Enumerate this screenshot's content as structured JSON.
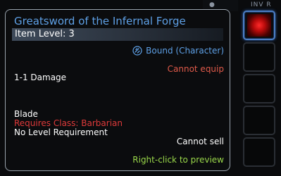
{
  "background": {
    "top_text": "INV R"
  },
  "tooltip": {
    "title": "Greatsword of the Infernal Forge",
    "item_level": "Item Level: 3",
    "bound": "Bound (Character)",
    "cannot_equip": "Cannot equip",
    "damage": "1-1 Damage",
    "type": "Blade",
    "requires_class": "Requires Class: Barbarian",
    "level_requirement": "No Level Requirement",
    "cannot_sell": "Cannot sell",
    "preview_hint": "Right-click to preview"
  },
  "inventory": {
    "slots": [
      {
        "state": "selected",
        "icon": "red-swirl-sword-icon"
      },
      {
        "state": "empty"
      },
      {
        "state": "empty"
      },
      {
        "state": "empty"
      },
      {
        "state": "empty"
      }
    ]
  },
  "colors": {
    "title": "#5ea0e6",
    "bound": "#5ea0e6",
    "warning": "#e05a4a",
    "requirement_fail": "#e03a3a",
    "hint": "#9ad84a",
    "border": "#9aa3ad"
  }
}
